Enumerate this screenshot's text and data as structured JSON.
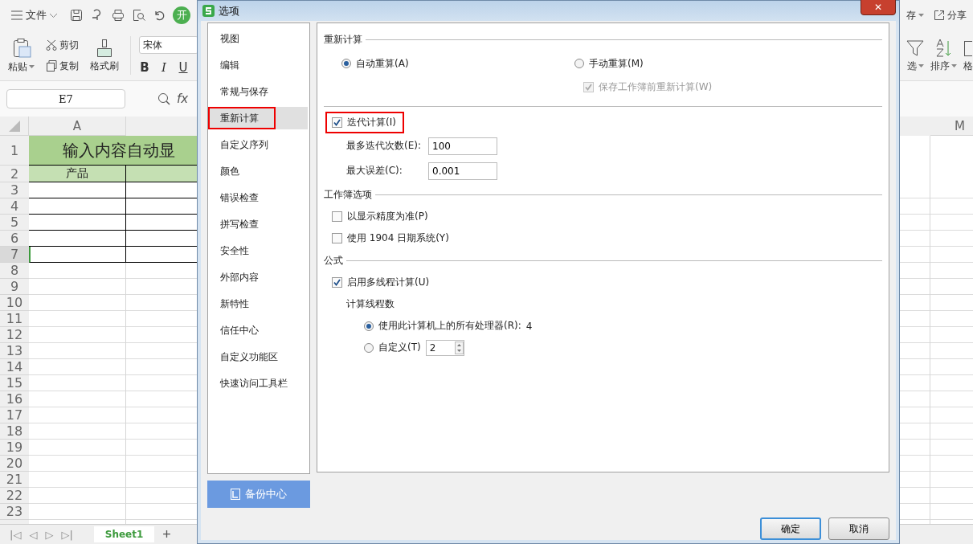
{
  "toolbar": {
    "menu_label": "文件",
    "user_badge": "开",
    "save_label": "存",
    "share_label": "分享"
  },
  "ribbon": {
    "paste": "粘贴",
    "cut": "剪切",
    "copy": "复制",
    "format_painter": "格式刷",
    "font": "宋体",
    "bold": "B",
    "italic": "I",
    "underline": "U",
    "filter": "选",
    "sort": "排序",
    "cut_off": "格"
  },
  "formula_bar": {
    "name_box": "E7",
    "fx": "fx"
  },
  "sheet": {
    "columns": [
      {
        "label": "A"
      },
      {
        "label": "M"
      }
    ],
    "title": "输入内容自动显",
    "header_cell": "产品",
    "rows": [
      {
        "label": "1",
        "selected": false
      },
      {
        "label": "2",
        "selected": false
      },
      {
        "label": "3",
        "selected": false
      },
      {
        "label": "4",
        "selected": false
      },
      {
        "label": "5",
        "selected": false
      },
      {
        "label": "6",
        "selected": false
      },
      {
        "label": "7",
        "selected": true
      },
      {
        "label": "8",
        "selected": false
      },
      {
        "label": "9",
        "selected": false
      },
      {
        "label": "10",
        "selected": false
      },
      {
        "label": "11",
        "selected": false
      },
      {
        "label": "12",
        "selected": false
      },
      {
        "label": "13",
        "selected": false
      },
      {
        "label": "14",
        "selected": false
      },
      {
        "label": "15",
        "selected": false
      },
      {
        "label": "16",
        "selected": false
      },
      {
        "label": "17",
        "selected": false
      },
      {
        "label": "18",
        "selected": false
      },
      {
        "label": "19",
        "selected": false
      },
      {
        "label": "20",
        "selected": false
      },
      {
        "label": "21",
        "selected": false
      },
      {
        "label": "22",
        "selected": false
      },
      {
        "label": "23",
        "selected": false
      }
    ],
    "nav_buttons": [
      "|◁",
      "◁",
      "▷",
      "▷|"
    ],
    "tabs": [
      {
        "label": "Sheet1",
        "selected": true
      }
    ],
    "add_tab": "+"
  },
  "dialog": {
    "title": "选项",
    "close": "✕",
    "nav": [
      {
        "label": "视图",
        "selected": false,
        "highlighted": false
      },
      {
        "label": "编辑",
        "selected": false,
        "highlighted": false
      },
      {
        "label": "常规与保存",
        "selected": false,
        "highlighted": false
      },
      {
        "label": "重新计算",
        "selected": true,
        "highlighted": true
      },
      {
        "label": "自定义序列",
        "selected": false,
        "highlighted": false
      },
      {
        "label": "颜色",
        "selected": false,
        "highlighted": false
      },
      {
        "label": "错误检查",
        "selected": false,
        "highlighted": false
      },
      {
        "label": "拼写检查",
        "selected": false,
        "highlighted": false
      },
      {
        "label": "安全性",
        "selected": false,
        "highlighted": false
      },
      {
        "label": "外部内容",
        "selected": false,
        "highlighted": false
      },
      {
        "label": "新特性",
        "selected": false,
        "highlighted": false
      },
      {
        "label": "信任中心",
        "selected": false,
        "highlighted": false
      },
      {
        "label": "自定义功能区",
        "selected": false,
        "highlighted": false
      },
      {
        "label": "快速访问工具栏",
        "selected": false,
        "highlighted": false
      }
    ],
    "backup_button": "备份中心",
    "content": [
      {
        "kind": "heading",
        "label": "重新计算"
      },
      {
        "kind": "radio-pair",
        "options": [
          {
            "label": "自动重算(A)",
            "selected": true
          },
          {
            "label": "手动重算(M)",
            "selected": false
          }
        ]
      },
      {
        "kind": "sub-checkbox",
        "label": "保存工作簿前重新计算(W)",
        "checked": true,
        "disabled": true
      },
      {
        "kind": "rule"
      },
      {
        "kind": "checkbox",
        "label": "迭代计算(I)",
        "checked": true,
        "disabled": false,
        "highlighted": true
      },
      {
        "kind": "field",
        "label": "最多迭代次数(E):",
        "value": "100"
      },
      {
        "kind": "field",
        "label": "最大误差(C):",
        "value": "0.001"
      },
      {
        "kind": "heading",
        "label": "工作簿选项"
      },
      {
        "kind": "checkbox",
        "label": "以显示精度为准(P)",
        "checked": false,
        "disabled": false,
        "highlighted": false
      },
      {
        "kind": "checkbox",
        "label": "使用 1904 日期系统(Y)",
        "checked": false,
        "disabled": false,
        "highlighted": false
      },
      {
        "kind": "heading",
        "label": "公式"
      },
      {
        "kind": "checkbox",
        "label": "启用多线程计算(U)",
        "checked": true,
        "disabled": false,
        "highlighted": false
      },
      {
        "kind": "label",
        "label": "计算线程数"
      },
      {
        "kind": "radio",
        "label": "使用此计算机上的所有处理器(R):",
        "selected": true,
        "value": "4"
      },
      {
        "kind": "radio-spin",
        "label": "自定义(T)",
        "selected": false,
        "value": "2"
      }
    ],
    "buttons": [
      {
        "label": "确定",
        "default": true
      },
      {
        "label": "取消",
        "default": false
      }
    ]
  }
}
